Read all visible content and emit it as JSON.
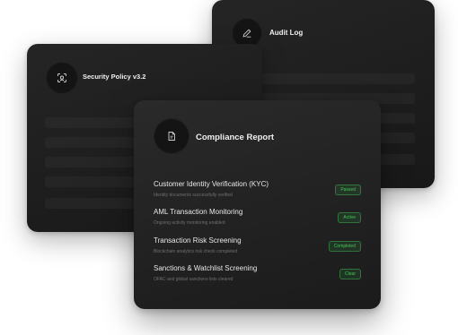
{
  "cards": {
    "audit": {
      "title": "Audit Log",
      "icon": "pen-icon"
    },
    "policy": {
      "title": "Security Policy v3.2",
      "icon": "face-scan-icon"
    },
    "report": {
      "title": "Compliance Report",
      "icon": "document-icon"
    }
  },
  "compliance_items": [
    {
      "title": "Customer Identity Verification (KYC)",
      "subtitle": "Identity documents successfully verified",
      "status": "Passed"
    },
    {
      "title": "AML Transaction Monitoring",
      "subtitle": "Ongoing activity monitoring enabled",
      "status": "Active"
    },
    {
      "title": "Transaction Risk Screening",
      "subtitle": "Blockchain analytics risk check completed",
      "status": "Completed"
    },
    {
      "title": "Sanctions & Watchlist Screening",
      "subtitle": "OFAC and global sanctions lists cleared",
      "status": "Clear"
    }
  ],
  "colors": {
    "card_background": "#1e1e1e",
    "badge_text": "#47c25a",
    "badge_border": "#2f7a3b"
  }
}
